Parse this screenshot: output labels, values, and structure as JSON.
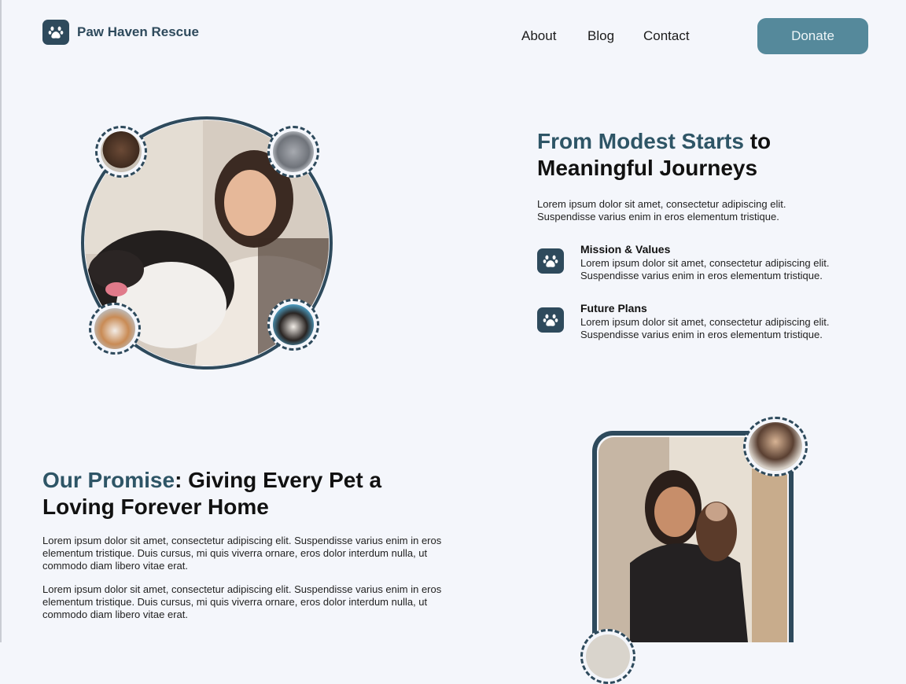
{
  "header": {
    "brand": "Paw Haven Rescue",
    "nav": [
      "About",
      "Blog",
      "Contact"
    ],
    "donate": "Donate"
  },
  "section1": {
    "title_accent": "From Modest Starts",
    "title_rest_1": " to",
    "title_rest_2": "Meaningful Journeys",
    "intro_1": "Lorem ipsum dolor sit amet, consectetur adipiscing elit.",
    "intro_2": "Suspendisse varius enim in eros elementum tristique.",
    "features": [
      {
        "title": "Mission & Values",
        "line1": "Lorem ipsum dolor sit amet, consectetur adipiscing elit.",
        "line2": "Suspendisse varius enim in eros elementum tristique."
      },
      {
        "title": "Future Plans",
        "line1": "Lorem ipsum dolor sit amet, consectetur adipiscing elit.",
        "line2": "Suspendisse varius enim in eros elementum tristique."
      }
    ]
  },
  "section2": {
    "title_accent": "Our Promise",
    "title_rest_1": ": Giving Every Pet a",
    "title_rest_2": "Loving Forever Home",
    "para1": [
      "Lorem ipsum dolor sit amet, consectetur adipiscing elit. Suspendisse varius enim in eros",
      "elementum tristique. Duis cursus, mi quis viverra ornare, eros dolor interdum nulla, ut",
      "commodo diam libero vitae erat."
    ],
    "para2": [
      "Lorem ipsum dolor sit amet, consectetur adipiscing elit. Suspendisse varius enim in eros",
      "elementum tristique. Duis cursus, mi quis viverra ornare, eros dolor interdum nulla, ut",
      "commodo diam libero vitae erat."
    ]
  },
  "colors": {
    "brand": "#2e4a5c",
    "accent_text": "#2e5566",
    "donate_bg": "#55899b",
    "background": "#f4f6fb"
  },
  "icons": {
    "logo": "paw-icon",
    "feature": "paw-icon"
  }
}
